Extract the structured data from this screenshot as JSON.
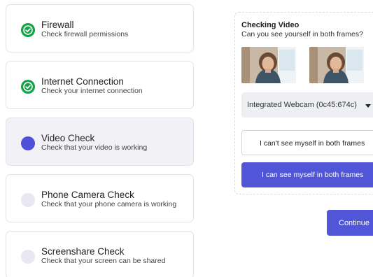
{
  "steps": [
    {
      "title": "Firewall",
      "description": "Check firewall permissions",
      "status": "complete"
    },
    {
      "title": "Internet Connection",
      "description": "Check your internet connection",
      "status": "complete"
    },
    {
      "title": "Video Check",
      "description": "Check that your video is working",
      "status": "current"
    },
    {
      "title": "Phone Camera Check",
      "description": "Check that your phone camera is working",
      "status": "pending"
    },
    {
      "title": "Screenshare Check",
      "description": "Check that your screen can be shared",
      "status": "pending"
    }
  ],
  "video_panel": {
    "title": "Checking Video",
    "question": "Can you see yourself in both frames?",
    "camera_select": "Integrated Webcam (0c45:674c)",
    "decline_label": "I can't see myself in both frames",
    "confirm_label": "I can see myself in both frames"
  },
  "continue_label": "Continue",
  "colors": {
    "accent": "#5156d8",
    "success": "#15a34a",
    "pending": "#e7e8f4"
  },
  "icons": {
    "complete": "check-circle-icon",
    "current": "current-step-dot-icon",
    "pending": "pending-step-dot-icon",
    "dropdown": "caret-down-icon"
  }
}
